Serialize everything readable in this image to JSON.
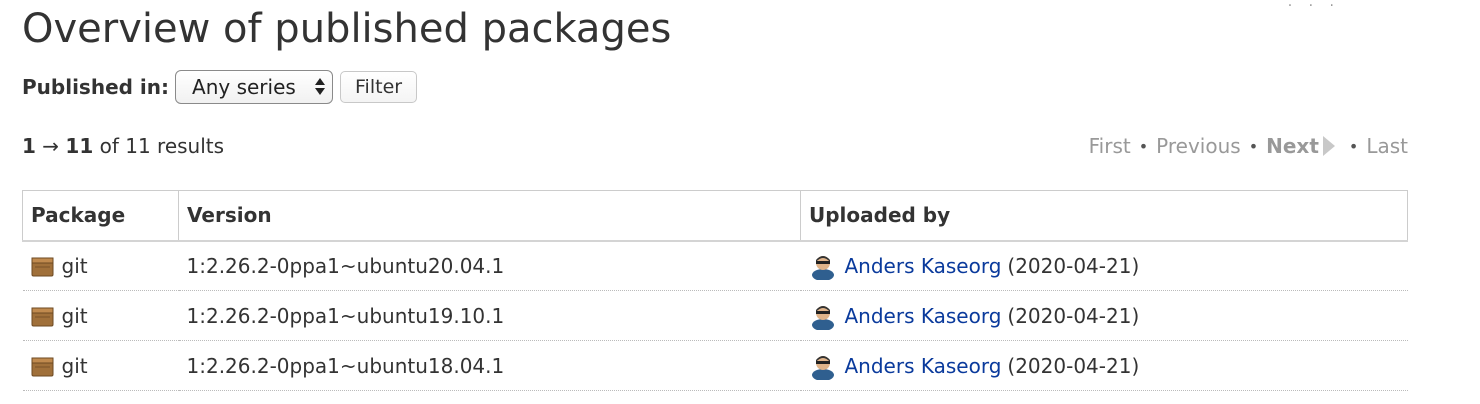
{
  "page": {
    "title": "Overview of published packages"
  },
  "filter": {
    "label": "Published in:",
    "series_selected": "Any series",
    "button_label": "Filter"
  },
  "results": {
    "range_start": "1",
    "arrow": "→",
    "range_end": "11",
    "of_text": "of 11 results"
  },
  "pagination": {
    "first": "First",
    "previous": "Previous",
    "next": "Next",
    "last": "Last",
    "separator": "•"
  },
  "table": {
    "headers": {
      "package": "Package",
      "version": "Version",
      "uploaded_by": "Uploaded by"
    },
    "rows": [
      {
        "package": "git",
        "version": "1:2.26.2-0ppa1~ubuntu20.04.1",
        "uploader": "Anders Kaseorg",
        "date": "(2020-04-21)"
      },
      {
        "package": "git",
        "version": "1:2.26.2-0ppa1~ubuntu19.10.1",
        "uploader": "Anders Kaseorg",
        "date": "(2020-04-21)"
      },
      {
        "package": "git",
        "version": "1:2.26.2-0ppa1~ubuntu18.04.1",
        "uploader": "Anders Kaseorg",
        "date": "(2020-04-21)"
      }
    ]
  },
  "icons": {
    "package": "package-icon",
    "person": "person-icon",
    "select_arrows": "updown-arrows-icon",
    "next": "next-arrow-icon"
  },
  "colors": {
    "link": "#0a3a9c",
    "text": "#333333",
    "muted": "#999999",
    "package_icon": "#a0703a"
  }
}
